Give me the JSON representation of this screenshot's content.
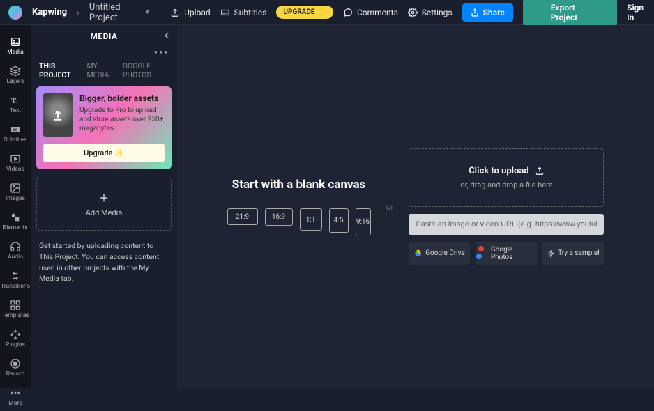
{
  "header": {
    "brand": "Kapwing",
    "project": "Untitled Project",
    "upload": "Upload",
    "subtitles": "Subtitles",
    "upgrade": "UPGRADE",
    "comments": "Comments",
    "settings": "Settings",
    "share": "Share",
    "export": "Export Project",
    "signin": "Sign In"
  },
  "rail": {
    "items": [
      {
        "label": "Media"
      },
      {
        "label": "Layers"
      },
      {
        "label": "Text"
      },
      {
        "label": "Subtitles"
      },
      {
        "label": "Videos"
      },
      {
        "label": "Images"
      },
      {
        "label": "Elements"
      },
      {
        "label": "Audio"
      },
      {
        "label": "Transitions"
      },
      {
        "label": "Templates"
      },
      {
        "label": "Plugins"
      },
      {
        "label": "Record"
      },
      {
        "label": "More"
      }
    ]
  },
  "side": {
    "title": "MEDIA",
    "tabs": {
      "project": "THIS PROJECT",
      "mymedia": "MY MEDIA",
      "gphotos": "GOOGLE PHOTOS"
    },
    "promo": {
      "title": "Bigger, bolder assets",
      "desc": "Upgrade to Pro to upload and store assets over 250+ megabytes.",
      "cta": "Upgrade ✨"
    },
    "add": "Add Media",
    "help": "Get started by uploading content to This Project. You can access content used in other projects with the My Media tab."
  },
  "canvas": {
    "blank_title": "Start with a blank canvas",
    "ratios": {
      "r1": "21:9",
      "r2": "16:9",
      "r3": "1:1",
      "r4": "4:5",
      "r5": "9:16"
    },
    "or": "or",
    "upload": {
      "title": "Click to upload",
      "sub": "or, drag and drop a file here",
      "placeholder": "Paste an image or video URL (e.g. https://www.youtube.com",
      "gdrive": "Google Drive",
      "gphotos": "Google Photos",
      "sample": "Try a sample!"
    }
  }
}
